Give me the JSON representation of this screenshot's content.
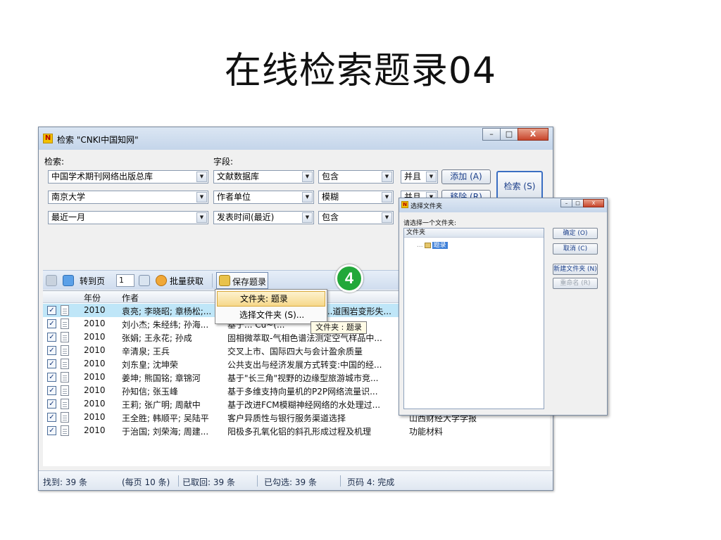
{
  "slide": {
    "title": "在线检索题录04"
  },
  "window": {
    "icon_letter": "N",
    "title": "检索 \"CNKI中国知网\"",
    "min_glyph": "–",
    "max_glyph": "□",
    "close_glyph": "X"
  },
  "search": {
    "label_search": "检索:",
    "label_field": "字段:",
    "rows": [
      {
        "source": "中国学术期刊网络出版总库",
        "field": "文献数据库",
        "match": "包含",
        "logic": "并且"
      },
      {
        "source": "南京大学",
        "field": "作者单位",
        "match": "模糊",
        "logic": "并且"
      },
      {
        "source": "最近一月",
        "field": "发表时间(最近)",
        "match": "包含"
      }
    ],
    "add_button": "添加 (A)",
    "remove_button": "移除 (R)",
    "search_button": "检索 (S)"
  },
  "toolbar": {
    "goto_label": "转到页",
    "page_value": "1",
    "batch_label": "批量获取",
    "save_label": "保存题录"
  },
  "step_badge": "4",
  "table": {
    "col_year": "年份",
    "col_author": "作者",
    "rows": [
      {
        "year": "2010",
        "author": "袁亮; 李晓昭; 章杨松;...",
        "title": "...道围岩变形失...",
        "source": "",
        "checked": "✓"
      },
      {
        "year": "2010",
        "author": "刘小杰; 朱经纬; 孙海...",
        "title": "基于... Cu~(...",
        "source": "",
        "checked": "✓"
      },
      {
        "year": "2010",
        "author": "张娟; 王永花; 孙成",
        "title": "固相微萃取-气相色谱法测定空气样品中...",
        "source": "",
        "checked": "✓"
      },
      {
        "year": "2010",
        "author": "辛清泉; 王兵",
        "title": "交叉上市、国际四大与会计盈余质量",
        "source": "",
        "checked": "✓"
      },
      {
        "year": "2010",
        "author": "刘东皇; 沈坤荣",
        "title": "公共支出与经济发展方式转变:中国的经...",
        "source": "",
        "checked": "✓"
      },
      {
        "year": "2010",
        "author": "姜坤; 熊国铭; 章锦河",
        "title": "基于\"长三角\"视野的边缘型旅游城市竞...",
        "source": "",
        "checked": "✓"
      },
      {
        "year": "2010",
        "author": "孙知信; 张玉峰",
        "title": "基于多维支持向量机的P2P网络流量识...",
        "source": "",
        "checked": "✓"
      },
      {
        "year": "2010",
        "author": "王莉; 张广明; 周献中",
        "title": "基于改进FCM模糊神经网络的水处理过...",
        "source": "",
        "checked": "✓"
      },
      {
        "year": "2010",
        "author": "王全胜; 韩顺平; 吴陆平",
        "title": "客户异质性与银行服务渠道选择",
        "source": "山西财经大学学报",
        "checked": "✓"
      },
      {
        "year": "2010",
        "author": "于治国; 刘荣海; 周建...",
        "title": "阳极多孔氧化铝的斜孔形成过程及机理",
        "source": "功能材料",
        "checked": "✓"
      }
    ]
  },
  "menu": {
    "item_folder": "文件夹: 题录",
    "item_choose": "选择文件夹 (S)..."
  },
  "tooltip": "文件夹 : 题录",
  "status": {
    "found": "找到: 39 条",
    "per_page": "(每页 10 条)",
    "fetched": "已取回: 39 条",
    "checked": "已勾选: 39 条",
    "page_done": "页码 4: 完成"
  },
  "dialog": {
    "icon_letter": "N",
    "title": "选择文件夹",
    "min_glyph": "–",
    "max_glyph": "□",
    "close_glyph": "X",
    "prompt": "请选择一个文件夹:",
    "tree_header": "文件夹",
    "tree_branch": "...",
    "folder_name": "题录",
    "ok_button": "确定 (O)",
    "cancel_button": "取消 (C)",
    "new_folder_button": "新建文件夹 (N)",
    "rename_button": "重命名 (R)"
  }
}
